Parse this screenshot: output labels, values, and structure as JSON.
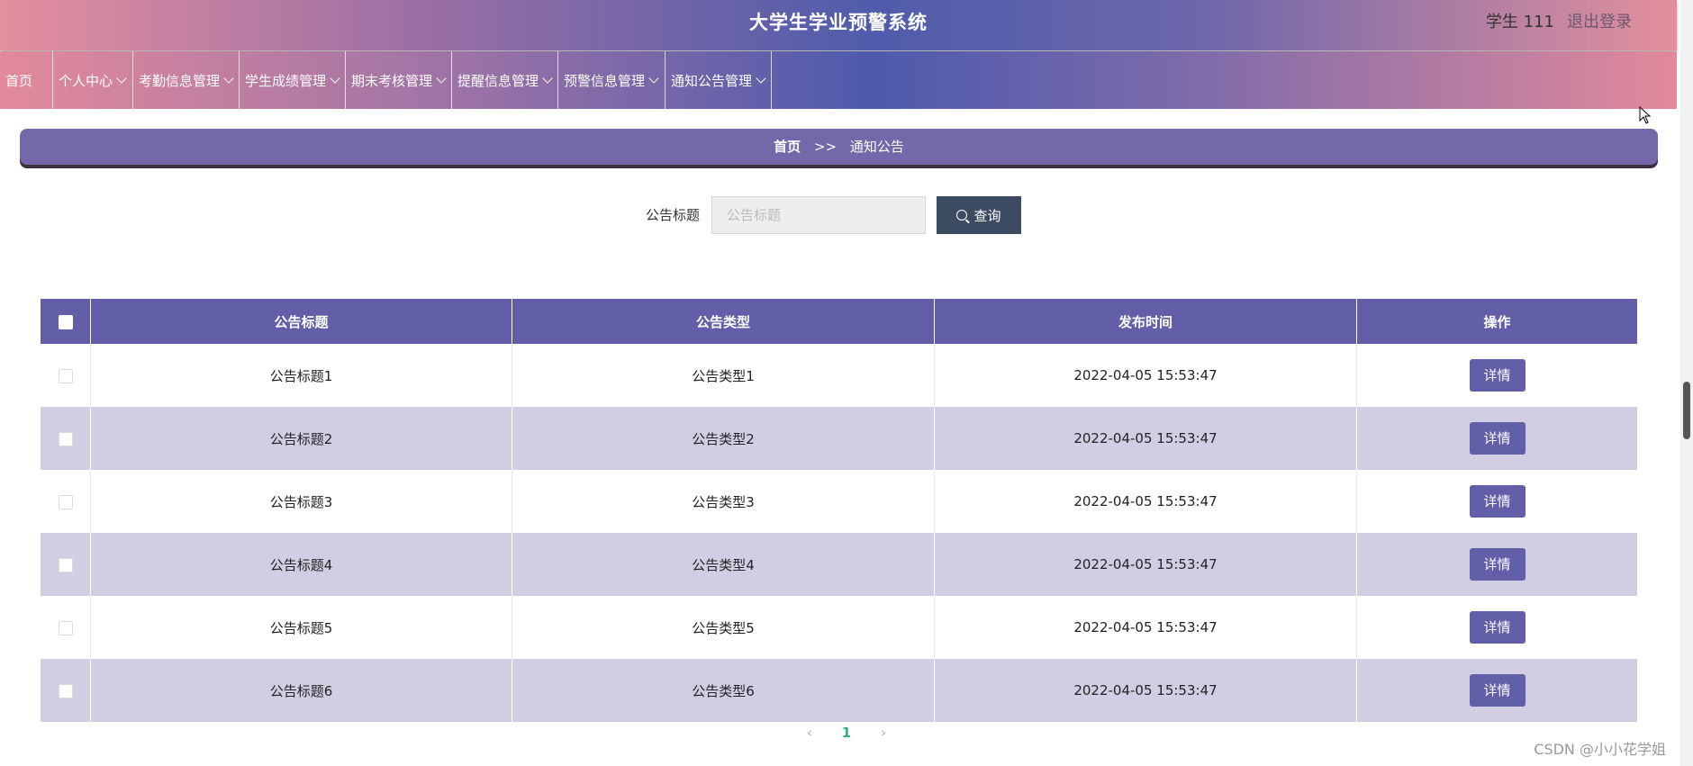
{
  "header": {
    "title": "大学生学业预警系统",
    "user": "学生 111",
    "logout": "退出登录"
  },
  "nav": {
    "items": [
      {
        "label": "首页",
        "dropdown": false
      },
      {
        "label": "个人中心",
        "dropdown": true
      },
      {
        "label": "考勤信息管理",
        "dropdown": true
      },
      {
        "label": "学生成绩管理",
        "dropdown": true
      },
      {
        "label": "期末考核管理",
        "dropdown": true
      },
      {
        "label": "提醒信息管理",
        "dropdown": true
      },
      {
        "label": "预警信息管理",
        "dropdown": true
      },
      {
        "label": "通知公告管理",
        "dropdown": true
      }
    ]
  },
  "breadcrumb": {
    "home": "首页",
    "separator": ">>",
    "current": "通知公告"
  },
  "search": {
    "label": "公告标题",
    "placeholder": "公告标题",
    "button": "查询"
  },
  "table": {
    "columns": [
      "公告标题",
      "公告类型",
      "发布时间",
      "操作"
    ],
    "rows": [
      {
        "title": "公告标题1",
        "type": "公告类型1",
        "time": "2022-04-05 15:53:47",
        "action": "详情"
      },
      {
        "title": "公告标题2",
        "type": "公告类型2",
        "time": "2022-04-05 15:53:47",
        "action": "详情"
      },
      {
        "title": "公告标题3",
        "type": "公告类型3",
        "time": "2022-04-05 15:53:47",
        "action": "详情"
      },
      {
        "title": "公告标题4",
        "type": "公告类型4",
        "time": "2022-04-05 15:53:47",
        "action": "详情"
      },
      {
        "title": "公告标题5",
        "type": "公告类型5",
        "time": "2022-04-05 15:53:47",
        "action": "详情"
      },
      {
        "title": "公告标题6",
        "type": "公告类型6",
        "time": "2022-04-05 15:53:47",
        "action": "详情"
      }
    ]
  },
  "pagination": {
    "prev": "‹",
    "page": "1",
    "next": "›"
  },
  "watermark": "CSDN @小小花学姐",
  "colors": {
    "accent": "#625ea8",
    "row_alt": "#d1cee3",
    "search_button": "#3d4b62",
    "breadcrumb_bg": "#7467aa",
    "page_active": "#2bb673"
  }
}
